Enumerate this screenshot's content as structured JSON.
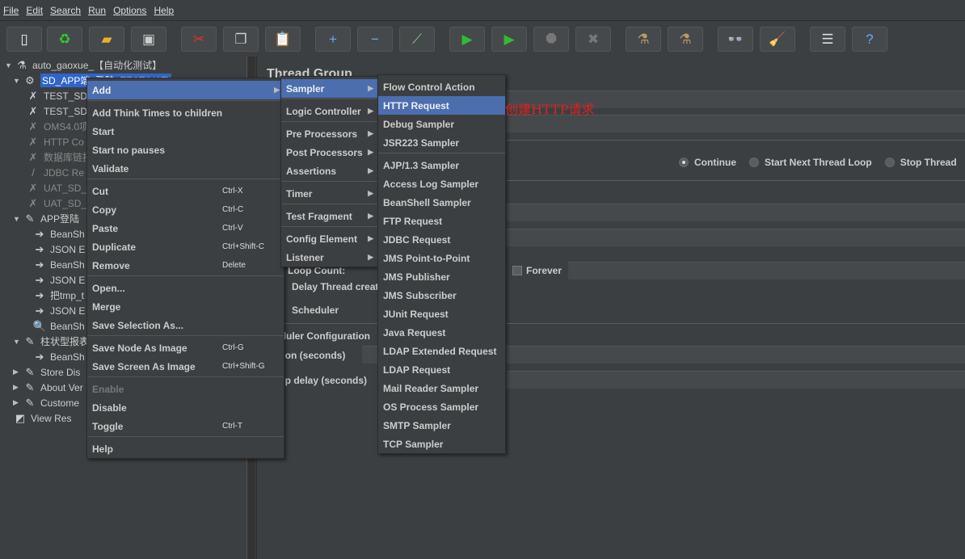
{
  "menubar": [
    "File",
    "Edit",
    "Search",
    "Run",
    "Options",
    "Help"
  ],
  "toolbar": [
    {
      "name": "new-icon",
      "glyph": "▯",
      "color": "#eee"
    },
    {
      "name": "templates-icon",
      "glyph": "♻",
      "color": "#3c3"
    },
    {
      "name": "open-icon",
      "glyph": "▰",
      "color": "#e8b030"
    },
    {
      "name": "save-icon",
      "glyph": "▣",
      "color": "#ccc"
    },
    {
      "name": "cut-icon",
      "glyph": "✂",
      "color": "#d33"
    },
    {
      "name": "copy-icon",
      "glyph": "❐",
      "color": "#ccc"
    },
    {
      "name": "paste-icon",
      "glyph": "📋",
      "color": "#c90"
    },
    {
      "name": "expand-icon",
      "glyph": "+",
      "color": "#6af"
    },
    {
      "name": "collapse-icon",
      "glyph": "−",
      "color": "#6af"
    },
    {
      "name": "toggle-icon",
      "glyph": "⟋",
      "color": "#8c8"
    },
    {
      "name": "start-icon",
      "glyph": "▶",
      "color": "#3b3"
    },
    {
      "name": "start-no-pauses-icon",
      "glyph": "▶",
      "color": "#3b3"
    },
    {
      "name": "stop-icon",
      "glyph": "⯃",
      "color": "#777"
    },
    {
      "name": "shutdown-icon",
      "glyph": "✖",
      "color": "#777"
    },
    {
      "name": "clear-icon",
      "glyph": "⚗",
      "color": "#b96"
    },
    {
      "name": "clear-all-icon",
      "glyph": "⚗",
      "color": "#b96"
    },
    {
      "name": "search-icon",
      "glyph": "👓",
      "color": "#ddd"
    },
    {
      "name": "reset-search-icon",
      "glyph": "🧹",
      "color": "#fc0"
    },
    {
      "name": "function-helper-icon",
      "glyph": "☰",
      "color": "#ddd"
    },
    {
      "name": "help-icon",
      "glyph": "?",
      "color": "#6af"
    }
  ],
  "tree": [
    {
      "label": "auto_gaoxue_【自动化测试】",
      "level": 0,
      "tog": "▼",
      "icon": "flask-icon",
      "glyph": "⚗"
    },
    {
      "label": "SD_APP端_登陆_TEST(UAT)",
      "level": 1,
      "tog": "▼",
      "icon": "gear-icon",
      "glyph": "⚙",
      "selected": true
    },
    {
      "label": "TEST_SD",
      "level": 2,
      "icon": "config-icon",
      "glyph": "✗"
    },
    {
      "label": "TEST_SD",
      "level": 2,
      "icon": "config-icon",
      "glyph": "✗"
    },
    {
      "label": "OMS4.0项",
      "level": 2,
      "icon": "config-icon",
      "glyph": "✗",
      "disabled": true
    },
    {
      "label": "HTTP Co",
      "level": 2,
      "icon": "config-icon",
      "glyph": "✗",
      "disabled": true
    },
    {
      "label": "数据库链接",
      "level": 2,
      "icon": "config-icon",
      "glyph": "✗",
      "disabled": true
    },
    {
      "label": "JDBC Re",
      "level": 2,
      "icon": "jdbc-icon",
      "glyph": "/",
      "disabled": true
    },
    {
      "label": "UAT_SD_",
      "level": 2,
      "icon": "config-icon",
      "glyph": "✗",
      "disabled": true
    },
    {
      "label": "UAT_SD_",
      "level": 2,
      "icon": "config-icon",
      "glyph": "✗",
      "disabled": true
    },
    {
      "label": "APP登陆",
      "level": 1,
      "tog": "▼",
      "icon": "sampler-icon",
      "glyph": "✎"
    },
    {
      "label": "BeanSh",
      "level": 3,
      "icon": "preprocessor-icon",
      "glyph": "➔"
    },
    {
      "label": "JSON E",
      "level": 3,
      "icon": "postprocessor-icon",
      "glyph": "➔"
    },
    {
      "label": "BeanSh",
      "level": 3,
      "icon": "postprocessor-icon",
      "glyph": "➔"
    },
    {
      "label": "JSON E",
      "level": 3,
      "icon": "postprocessor-icon",
      "glyph": "➔"
    },
    {
      "label": "把tmp_t",
      "level": 3,
      "icon": "postprocessor-icon",
      "glyph": "➔"
    },
    {
      "label": "JSON E",
      "level": 3,
      "icon": "postprocessor-icon",
      "glyph": "➔"
    },
    {
      "label": "BeanSh",
      "level": 3,
      "icon": "assertion-icon",
      "glyph": "🔍"
    },
    {
      "label": "柱状型报表",
      "level": 1,
      "tog": "▼",
      "icon": "sampler-icon",
      "glyph": "✎"
    },
    {
      "label": "BeanSh",
      "level": 3,
      "icon": "preprocessor-icon",
      "glyph": "➔"
    },
    {
      "label": "Store Dis",
      "level": 1,
      "tog": "▶",
      "icon": "sampler-icon",
      "glyph": "✎"
    },
    {
      "label": "About Ver",
      "level": 1,
      "tog": "▶",
      "icon": "sampler-icon",
      "glyph": "✎"
    },
    {
      "label": "Custome",
      "level": 1,
      "tog": "▶",
      "icon": "sampler-icon",
      "glyph": "✎"
    },
    {
      "label": "View Res",
      "level": 1,
      "icon": "listener-icon",
      "glyph": "◩"
    }
  ],
  "main": {
    "title": "Thread Group",
    "on_error": {
      "options": [
        "Continue",
        "Start Next Thread Loop",
        "Stop Thread"
      ],
      "selected": "Continue"
    },
    "loop_count_label": "Loop Count:",
    "forever_label": "Forever",
    "delay_label": "Delay Thread creation until needed",
    "scheduler_label": "Scheduler",
    "scheduler_config_label": "Scheduler Configuration",
    "duration_label": "Duration (seconds)",
    "startup_delay_label": "Startup delay (seconds)"
  },
  "context_menu": [
    {
      "label": "Add",
      "submenu": true,
      "highlighted": true
    },
    {
      "sep": true
    },
    {
      "label": "Add Think Times to children"
    },
    {
      "label": "Start"
    },
    {
      "label": "Start no pauses"
    },
    {
      "label": "Validate"
    },
    {
      "sep": true
    },
    {
      "label": "Cut",
      "shortcut": "Ctrl-X"
    },
    {
      "label": "Copy",
      "shortcut": "Ctrl-C"
    },
    {
      "label": "Paste",
      "shortcut": "Ctrl-V"
    },
    {
      "label": "Duplicate",
      "shortcut": "Ctrl+Shift-C"
    },
    {
      "label": "Remove",
      "shortcut": "Delete"
    },
    {
      "sep": true
    },
    {
      "label": "Open..."
    },
    {
      "label": "Merge"
    },
    {
      "label": "Save Selection As..."
    },
    {
      "sep": true
    },
    {
      "label": "Save Node As Image",
      "shortcut": "Ctrl-G"
    },
    {
      "label": "Save Screen As Image",
      "shortcut": "Ctrl+Shift-G"
    },
    {
      "sep": true
    },
    {
      "label": "Enable",
      "disabled": true
    },
    {
      "label": "Disable"
    },
    {
      "label": "Toggle",
      "shortcut": "Ctrl-T"
    },
    {
      "sep": true
    },
    {
      "label": "Help"
    }
  ],
  "add_menu": [
    {
      "label": "Sampler",
      "submenu": true,
      "highlighted": true
    },
    {
      "sep": true
    },
    {
      "label": "Logic Controller",
      "submenu": true
    },
    {
      "sep": true
    },
    {
      "label": "Pre Processors",
      "submenu": true
    },
    {
      "label": "Post Processors",
      "submenu": true
    },
    {
      "label": "Assertions",
      "submenu": true
    },
    {
      "sep": true
    },
    {
      "label": "Timer",
      "submenu": true
    },
    {
      "sep": true
    },
    {
      "label": "Test Fragment",
      "submenu": true
    },
    {
      "sep": true
    },
    {
      "label": "Config Element",
      "submenu": true
    },
    {
      "label": "Listener",
      "submenu": true
    }
  ],
  "sampler_menu": [
    {
      "label": "Flow Control Action"
    },
    {
      "label": "HTTP Request",
      "highlighted": true
    },
    {
      "label": "Debug Sampler"
    },
    {
      "label": "JSR223 Sampler"
    },
    {
      "sep": true
    },
    {
      "label": "AJP/1.3 Sampler"
    },
    {
      "label": "Access Log Sampler"
    },
    {
      "label": "BeanShell Sampler"
    },
    {
      "label": "FTP Request"
    },
    {
      "label": "JDBC Request"
    },
    {
      "label": "JMS Point-to-Point"
    },
    {
      "label": "JMS Publisher"
    },
    {
      "label": "JMS Subscriber"
    },
    {
      "label": "JUnit Request"
    },
    {
      "label": "Java Request"
    },
    {
      "label": "LDAP Extended Request"
    },
    {
      "label": "LDAP Request"
    },
    {
      "label": "Mail Reader Sampler"
    },
    {
      "label": "OS Process Sampler"
    },
    {
      "label": "SMTP Sampler"
    },
    {
      "label": "TCP Sampler"
    }
  ],
  "annotation": "创建HTTP请求",
  "colors": {
    "background": "#3c3f41",
    "highlight": "#4b6eaf",
    "selection": "#2f65ca",
    "annotation": "#e02020"
  }
}
